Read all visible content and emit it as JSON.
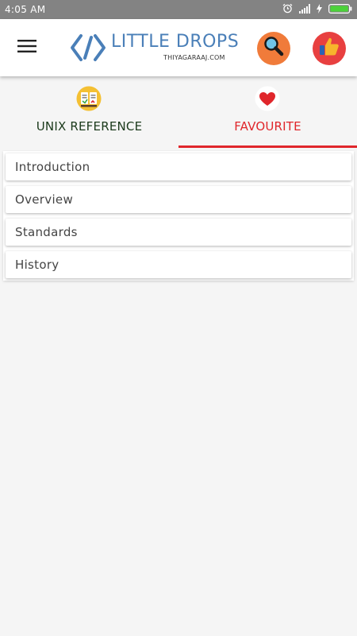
{
  "status_bar": {
    "time": "4:05 AM",
    "icons": [
      "alarm-icon",
      "signal-icon",
      "charging-icon",
      "battery-icon"
    ]
  },
  "app_bar": {
    "menu_icon": "hamburger-menu-icon",
    "logo_title": "LITTLE DROPS",
    "logo_subtitle": "THIYAGARAAJ.COM",
    "search_icon": "magnifier-icon",
    "like_icon": "thumbs-up-icon"
  },
  "tabs": [
    {
      "label": "UNIX REFERENCE",
      "icon": "reference-books-icon",
      "selected": false
    },
    {
      "label": "FAVOURITE",
      "icon": "heart-icon",
      "selected": true
    }
  ],
  "list": {
    "items": [
      {
        "label": "Introduction"
      },
      {
        "label": "Overview"
      },
      {
        "label": "Standards"
      },
      {
        "label": "History"
      }
    ]
  },
  "colors": {
    "status_bar_bg": "#838383",
    "accent_red": "#e0262b",
    "logo_blue": "#4a7fb8",
    "search_orange": "#f07b3a",
    "like_red": "#e84040",
    "unix_tab_text": "#1b3a1b",
    "background": "#f5f5f5"
  }
}
